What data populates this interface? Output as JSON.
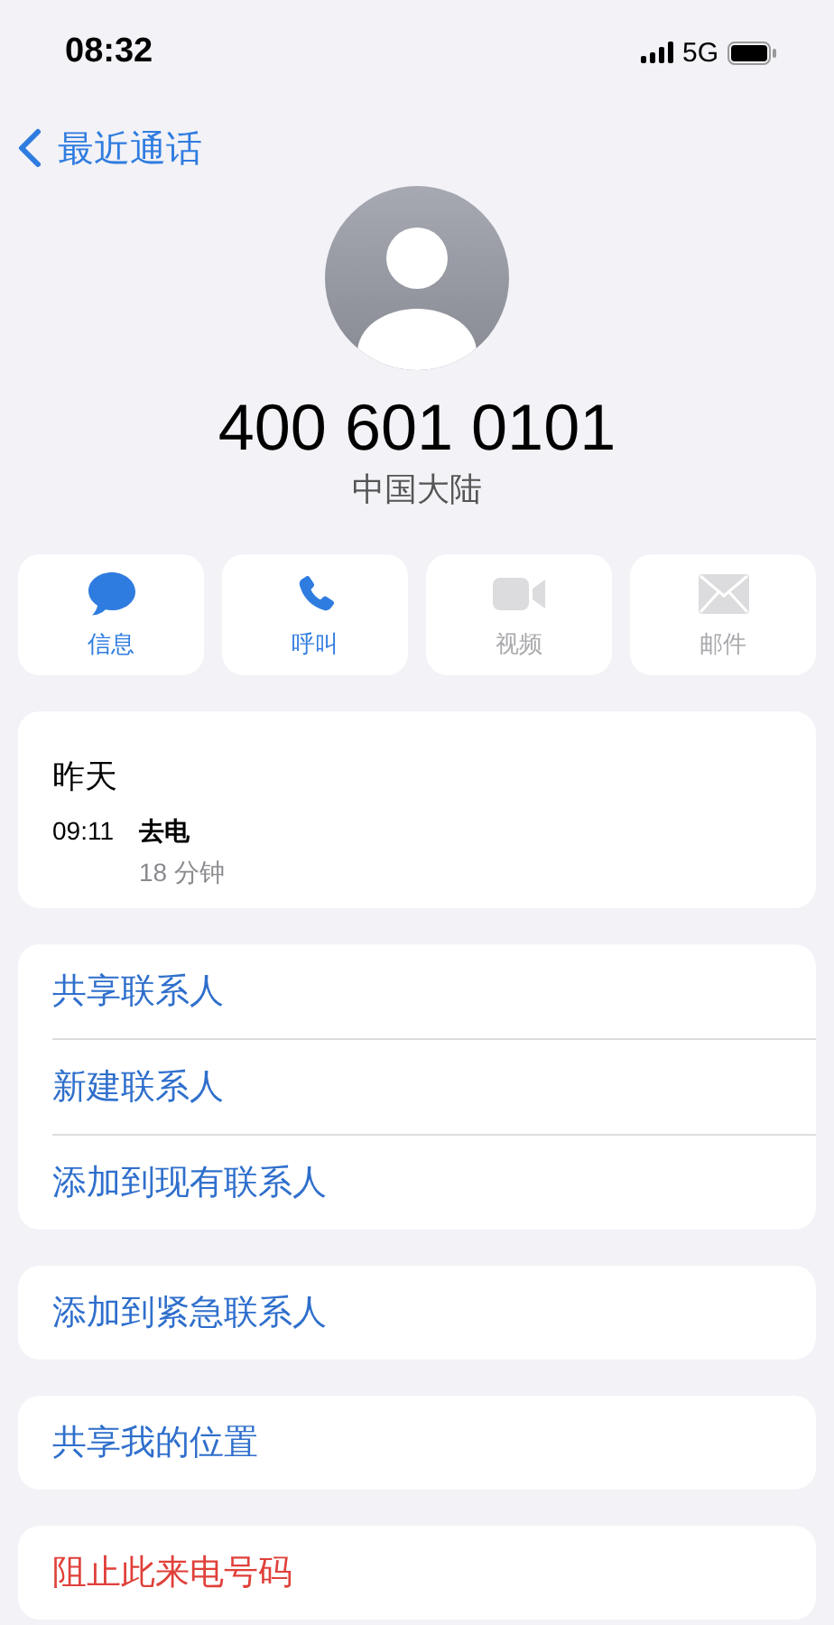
{
  "status_bar": {
    "time": "08:32",
    "network": "5G"
  },
  "nav": {
    "back_label": "最近通话"
  },
  "contact": {
    "number": "400 601 0101",
    "region": "中国大陆"
  },
  "actions": [
    {
      "kind": "message",
      "label": "信息",
      "disabled": false
    },
    {
      "kind": "call",
      "label": "呼叫",
      "disabled": false
    },
    {
      "kind": "video",
      "label": "视频",
      "disabled": true
    },
    {
      "kind": "mail",
      "label": "邮件",
      "disabled": true
    }
  ],
  "recents": {
    "day": "昨天",
    "calls": [
      {
        "time": "09:11",
        "type": "去电",
        "duration": "18 分钟"
      }
    ]
  },
  "groups": [
    {
      "items": [
        {
          "label": "共享联系人",
          "destructive": false
        },
        {
          "label": "新建联系人",
          "destructive": false
        },
        {
          "label": "添加到现有联系人",
          "destructive": false
        }
      ]
    },
    {
      "items": [
        {
          "label": "添加到紧急联系人",
          "destructive": false
        }
      ]
    },
    {
      "items": [
        {
          "label": "共享我的位置",
          "destructive": false
        }
      ]
    },
    {
      "items": [
        {
          "label": "阻止此来电号码",
          "destructive": true
        }
      ]
    }
  ]
}
